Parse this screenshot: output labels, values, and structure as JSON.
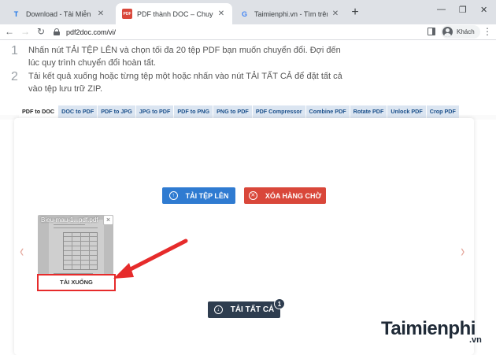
{
  "browser": {
    "tabs": [
      {
        "title": "Download - Tải Miễn Phí VN - Ph",
        "favicon": "T",
        "active": false
      },
      {
        "title": "PDF thành DOC – Chuyển đổi trự",
        "favicon": "PDF",
        "active": true
      },
      {
        "title": "Taimienphi.vn - Tìm trên Google",
        "favicon": "G",
        "active": false
      }
    ],
    "new_tab_label": "+",
    "url": "pdf2doc.com/vi/",
    "profile_label": "Khách",
    "window_controls": {
      "minimize": "—",
      "restore": "❐",
      "close": "✕"
    }
  },
  "page": {
    "steps": [
      {
        "number": "1",
        "text": "Nhấn nút TẢI TỆP LÊN và chọn tối đa 20 tệp PDF bạn muốn chuyển đổi. Đợi đến lúc quy trình chuyển đổi hoàn tất."
      },
      {
        "number": "2",
        "text": "Tải kết quả xuống hoặc từng tệp một hoặc nhấn vào nút TẢI TẤT CẢ để đặt tất cả vào tệp lưu trữ ZIP."
      }
    ],
    "format_tabs": [
      "PDF to DOC",
      "DOC to PDF",
      "PDF to JPG",
      "JPG to PDF",
      "PDF to PNG",
      "PNG to PDF",
      "PDF Compressor",
      "Combine PDF",
      "Rotate PDF",
      "Unlock PDF",
      "Crop PDF"
    ],
    "active_format_tab": "PDF to DOC",
    "upload_button": "TẢI TỆP LÊN",
    "clear_button": "XÓA HÀNG CHỜ",
    "download_all_button": "TẢI TẤT CẢ",
    "download_all_badge": "1",
    "file": {
      "name": "Bieu-mau-1...pdf.pdf",
      "download_label": "TẢI XUỐNG",
      "close": "×"
    },
    "carousel": {
      "prev": "‹",
      "next": "›"
    }
  },
  "watermark": {
    "brand": "aimienphi",
    "initial": "T",
    "suffix": ".vn"
  },
  "colors": {
    "upload": "#2f7bd1",
    "clear": "#d9473a",
    "download_all": "#2e3d4f",
    "highlight": "#e62b2b"
  }
}
